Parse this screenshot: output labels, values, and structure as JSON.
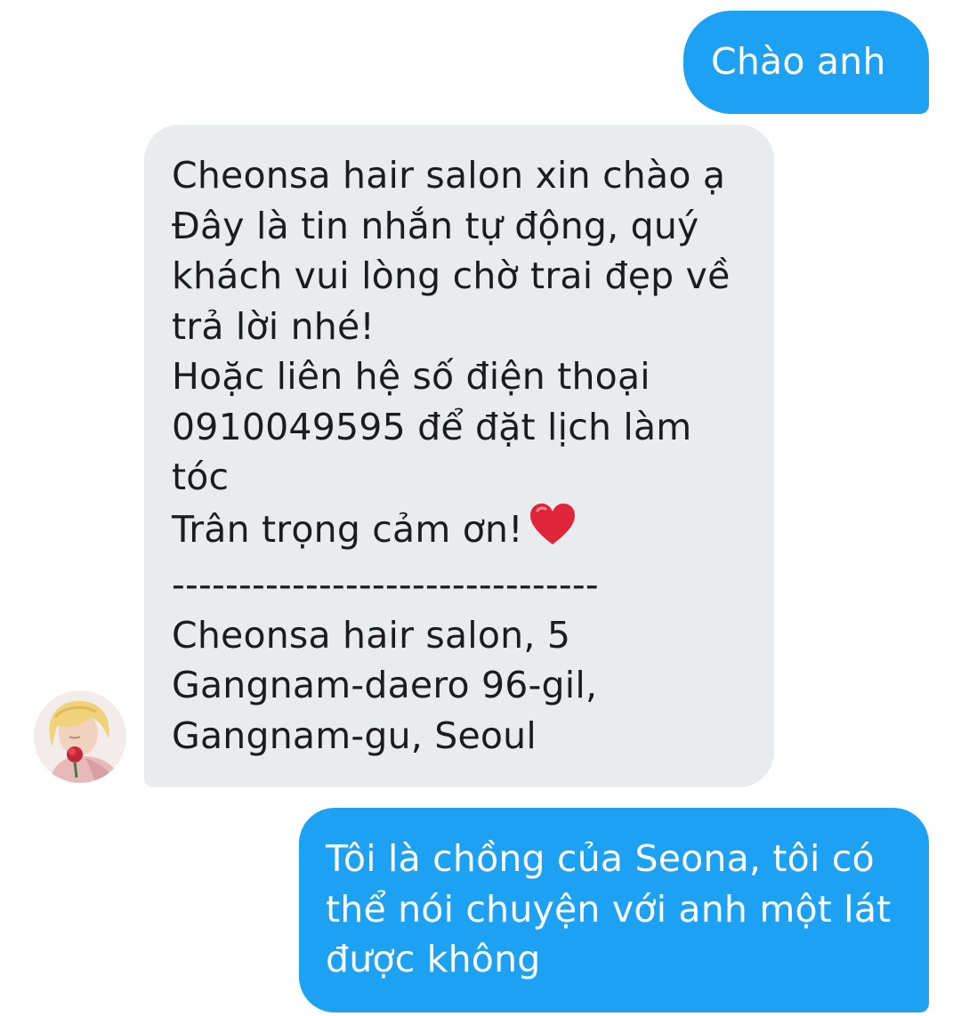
{
  "messages": [
    {
      "direction": "outgoing",
      "lines": [
        "Chào anh"
      ]
    },
    {
      "direction": "incoming",
      "lines": [
        "Cheonsa hair salon xin chào ạ",
        "Đây là tin nhắn tự động, quý",
        "khách vui lòng chờ trai đẹp về",
        "trả lời nhé!",
        "Hoặc liên hệ số điện thoại",
        "0910049595 để đặt lịch làm",
        "tóc",
        "Trân trọng cảm ơn!",
        "--------------------------------",
        "Cheonsa hair salon, 5",
        "Gangnam-daero 96-gil,",
        "Gangnam-gu, Seoul"
      ],
      "emoji": "heart-emoji-icon"
    },
    {
      "direction": "outgoing",
      "lines": [
        "Tôi là chồng của Seona, tôi có",
        "thể nói chuyện với anh một lát",
        "được không"
      ]
    }
  ],
  "sender_avatar": "avatar-photo-blonde-with-rose",
  "colors": {
    "outgoing_bubble": "#1da1f2",
    "incoming_bubble": "#e9ecef",
    "outgoing_text": "#ffffff",
    "incoming_text": "#1c1c1e",
    "heart": "#e0253a"
  }
}
